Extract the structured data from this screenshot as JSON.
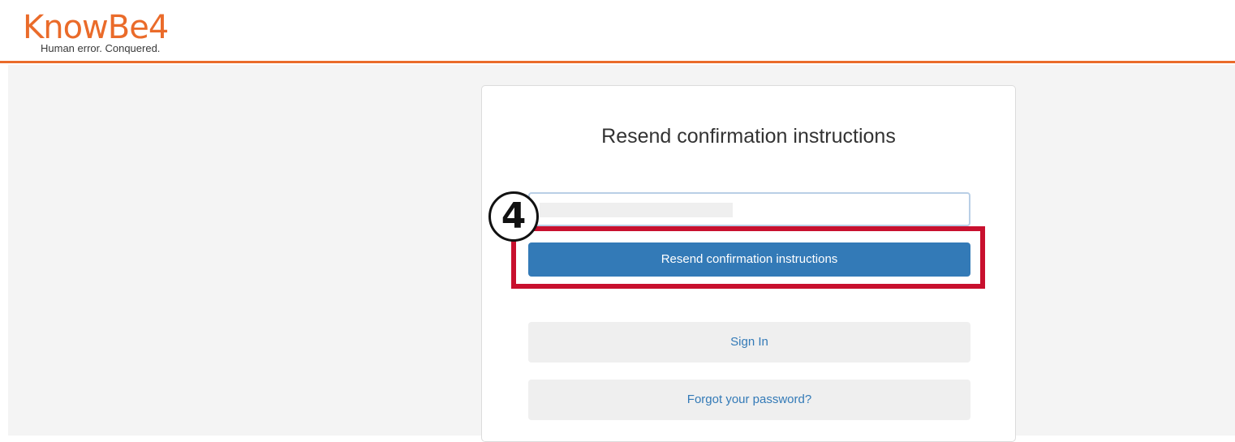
{
  "header": {
    "logo_name": "KnowBe4",
    "logo_tagline": "Human error. Conquered."
  },
  "card": {
    "title": "Resend confirmation instructions",
    "email_field": {
      "value": ""
    },
    "submit_label": "Resend confirmation instructions",
    "sign_in_label": "Sign In",
    "forgot_password_label": "Forgot your password?"
  },
  "annotation": {
    "step_number": "4"
  },
  "colors": {
    "brand_orange": "#ea6b2a",
    "primary_button": "#337ab7",
    "highlight_red": "#c8102e",
    "page_background": "#f4f4f4"
  }
}
